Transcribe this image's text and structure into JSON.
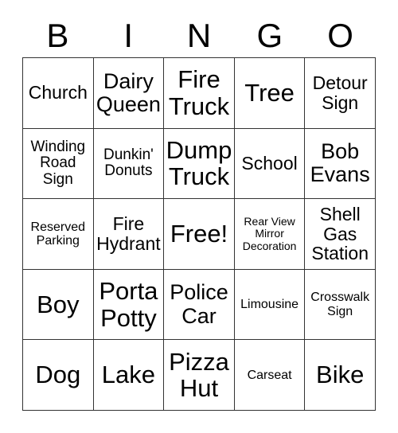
{
  "card": {
    "header_letters": [
      "B",
      "I",
      "N",
      "G",
      "O"
    ],
    "free_space_label": "Free!",
    "colors": {
      "text": "#000000",
      "border": "#333333",
      "background": "#ffffff"
    },
    "rows": [
      [
        {
          "label": "Church",
          "size": "fs-md"
        },
        {
          "label": "Dairy Queen",
          "size": "fs-lg"
        },
        {
          "label": "Fire Truck",
          "size": "fs-xl"
        },
        {
          "label": "Tree",
          "size": "fs-xl"
        },
        {
          "label": "Detour Sign",
          "size": "fs-md"
        }
      ],
      [
        {
          "label": "Winding Road Sign",
          "size": "fs-sm"
        },
        {
          "label": "Dunkin' Donuts",
          "size": "fs-sm"
        },
        {
          "label": "Dump Truck",
          "size": "fs-xl"
        },
        {
          "label": "School",
          "size": "fs-md"
        },
        {
          "label": "Bob Evans",
          "size": "fs-lg"
        }
      ],
      [
        {
          "label": "Reserved Parking",
          "size": "fs-xs"
        },
        {
          "label": "Fire Hydrant",
          "size": "fs-md"
        },
        {
          "label": "Free!",
          "size": "fs-xl"
        },
        {
          "label": "Rear View Mirror Decoration",
          "size": "fs-xxs"
        },
        {
          "label": "Shell Gas Station",
          "size": "fs-md"
        }
      ],
      [
        {
          "label": "Boy",
          "size": "fs-xl"
        },
        {
          "label": "Porta Potty",
          "size": "fs-xl"
        },
        {
          "label": "Police Car",
          "size": "fs-lg"
        },
        {
          "label": "Limousine",
          "size": "fs-xs"
        },
        {
          "label": "Crosswalk Sign",
          "size": "fs-xs"
        }
      ],
      [
        {
          "label": "Dog",
          "size": "fs-xl"
        },
        {
          "label": "Lake",
          "size": "fs-xl"
        },
        {
          "label": "Pizza Hut",
          "size": "fs-xl"
        },
        {
          "label": "Carseat",
          "size": "fs-xs"
        },
        {
          "label": "Bike",
          "size": "fs-xl"
        }
      ]
    ]
  }
}
